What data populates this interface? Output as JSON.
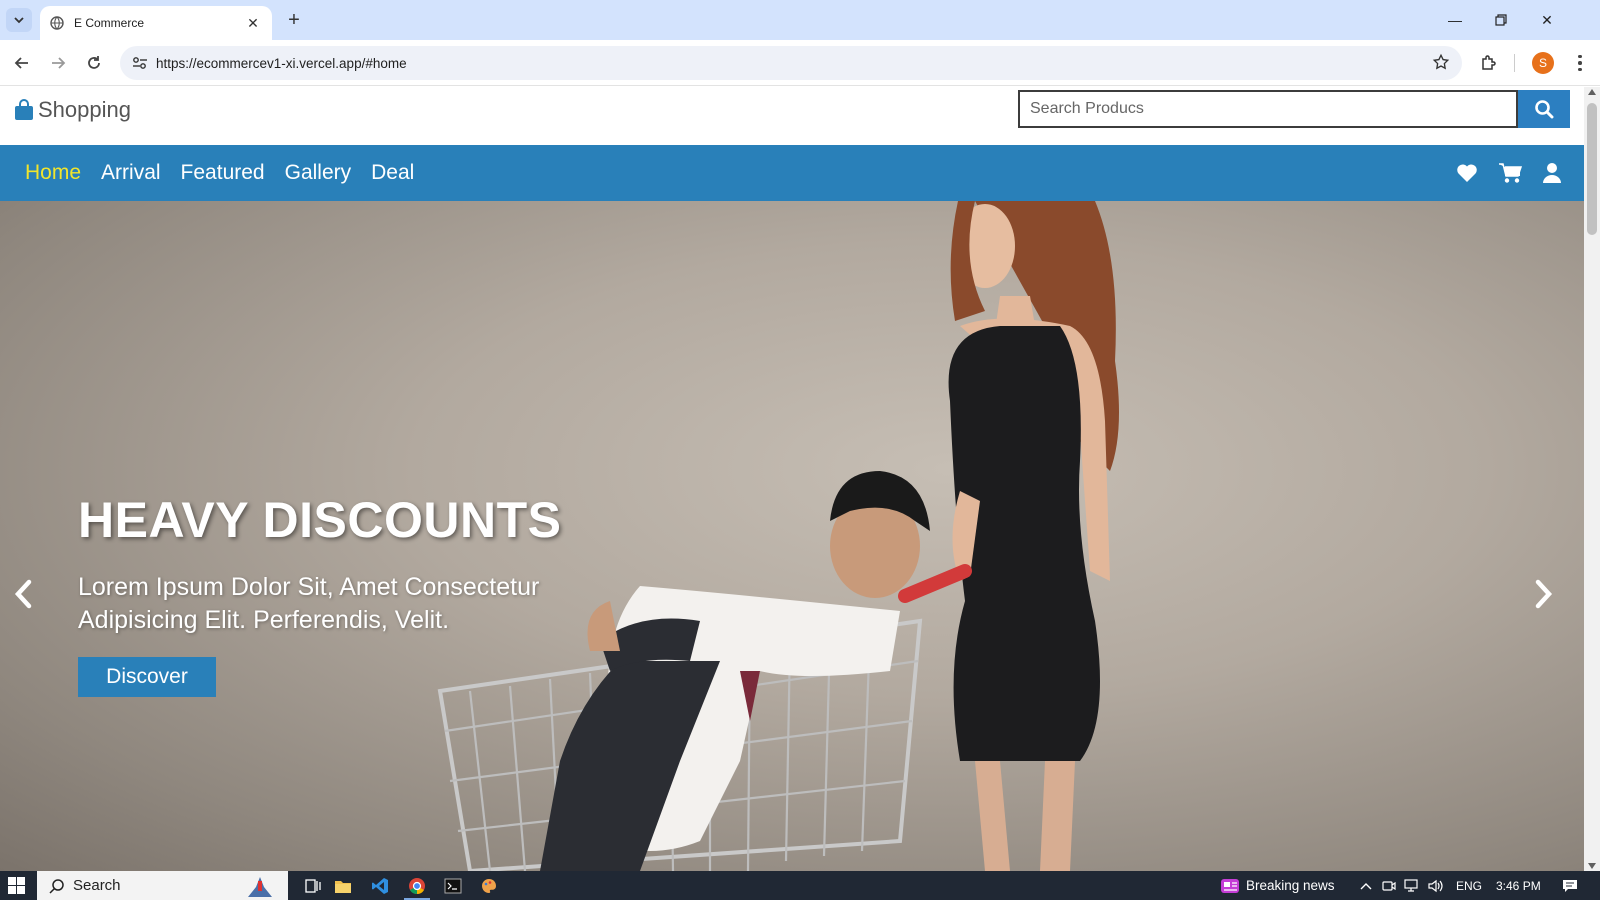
{
  "browser": {
    "tab_title": "E Commerce",
    "url": "https://ecommercev1-xi.vercel.app/#home",
    "profile_initial": "S"
  },
  "site": {
    "logo_text": "Shopping",
    "search_placeholder": "Search Producs",
    "nav": [
      {
        "label": "Home",
        "active": true
      },
      {
        "label": "Arrival",
        "active": false
      },
      {
        "label": "Featured",
        "active": false
      },
      {
        "label": "Gallery",
        "active": false
      },
      {
        "label": "Deal",
        "active": false
      }
    ],
    "nav_icons": [
      "heart-icon",
      "cart-icon",
      "user-icon"
    ],
    "colors": {
      "primary": "#2980b9",
      "active_nav": "#f1e52c"
    }
  },
  "hero": {
    "title": "HEAVY DISCOUNTS",
    "text": "Lorem Ipsum Dolor Sit, Amet Consectetur Adipisicing Elit. Perferendis, Velit.",
    "button": "Discover"
  },
  "taskbar": {
    "search_label": "Search",
    "news_label": "Breaking news",
    "language": "ENG",
    "time": "3:46 PM"
  }
}
